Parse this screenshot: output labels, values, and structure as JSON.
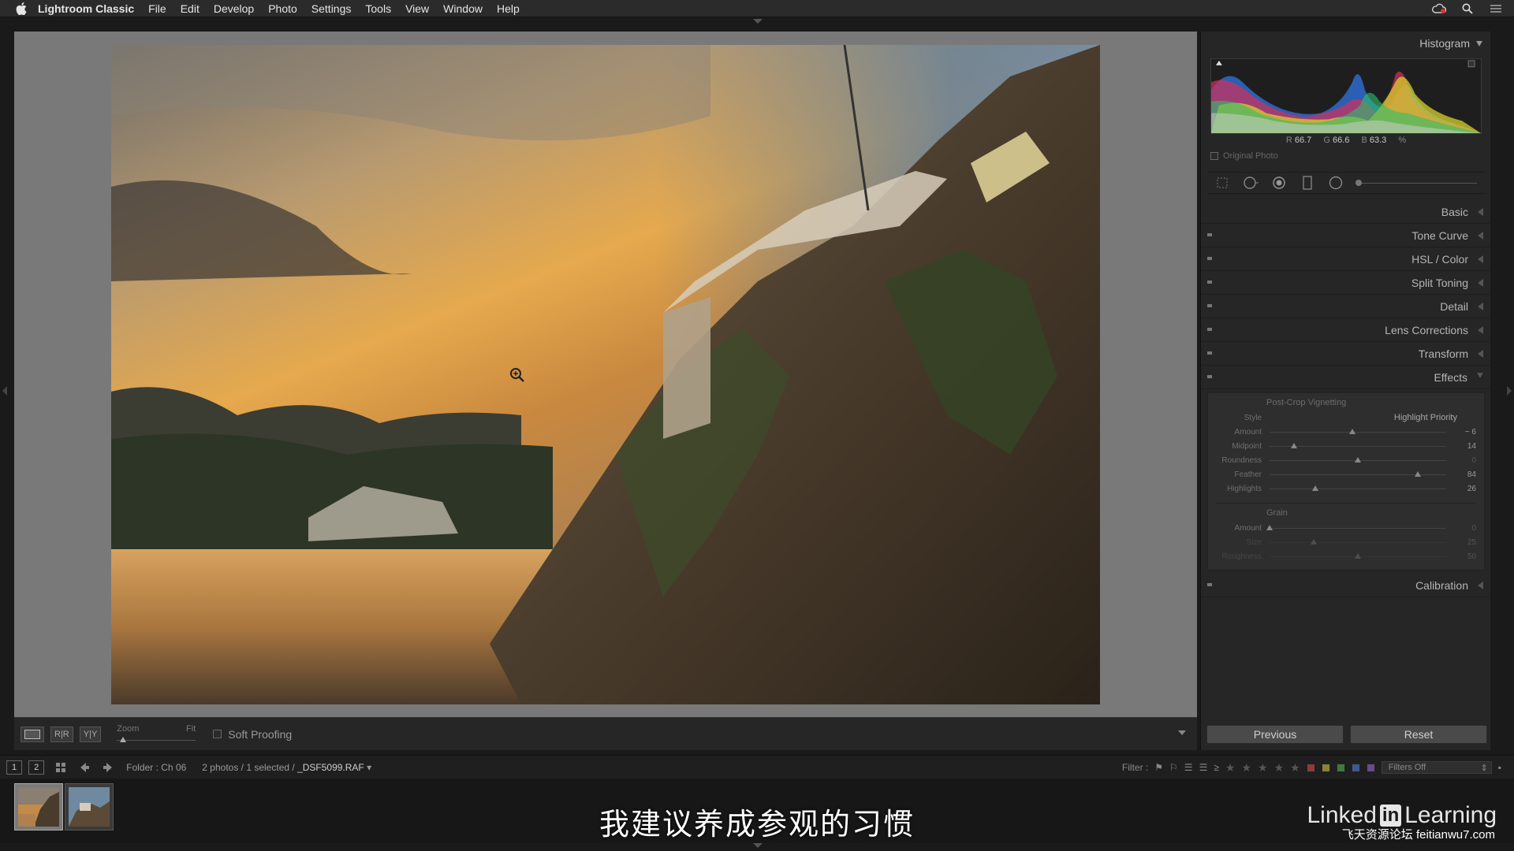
{
  "menubar": {
    "app_name": "Lightroom Classic",
    "items": [
      "File",
      "Edit",
      "Develop",
      "Photo",
      "Settings",
      "Tools",
      "View",
      "Window",
      "Help"
    ]
  },
  "toolbar": {
    "zoom_label": "Zoom",
    "fit_label": "Fit",
    "soft_proofing": "Soft Proofing"
  },
  "right_panel": {
    "histogram_title": "Histogram",
    "rgb": {
      "r_label": "R",
      "r_value": "66.7",
      "g_label": "G",
      "g_value": "66.6",
      "b_label": "B",
      "b_value": "63.3",
      "unit": "%"
    },
    "original_photo": "Original Photo",
    "sections": {
      "basic": "Basic",
      "tone_curve": "Tone Curve",
      "hsl_color": "HSL / Color",
      "split_toning": "Split Toning",
      "detail": "Detail",
      "lens_corrections": "Lens Corrections",
      "transform": "Transform",
      "effects": "Effects",
      "calibration": "Calibration"
    },
    "effects": {
      "vignette_title": "Post-Crop Vignetting",
      "style_label": "Style",
      "style_value": "Highlight Priority",
      "amount_label": "Amount",
      "amount_value": "− 6",
      "amount_level": 0.47,
      "midpoint_label": "Midpoint",
      "midpoint_value": "14",
      "midpoint_level": 0.14,
      "roundness_label": "Roundness",
      "roundness_value": "0",
      "roundness_level": 0.5,
      "feather_label": "Feather",
      "feather_value": "84",
      "feather_level": 0.84,
      "highlights_label": "Highlights",
      "highlights_value": "26",
      "highlights_level": 0.26,
      "grain_title": "Grain",
      "grain_amount_label": "Amount",
      "grain_amount_value": "0",
      "grain_amount_level": 0.0,
      "size_label": "Size",
      "size_value": "25",
      "size_level": 0.25,
      "roughness_label": "Roughness",
      "roughness_value": "50",
      "roughness_level": 0.5
    },
    "previous_button": "Previous",
    "reset_button": "Reset"
  },
  "filmstrip_bar": {
    "view1": "1",
    "view2": "2",
    "folder": "Folder : Ch 06",
    "count_prefix": "2 photos / 1 selected /",
    "filename": "_DSF5099.RAF",
    "filter_label": "Filter :",
    "filters_off": "Filters Off"
  },
  "colors": {
    "label_red": "#8a3c3c",
    "label_yellow": "#8a8336",
    "label_green": "#3e7a3e",
    "label_blue": "#3e5a8a",
    "label_purple": "#6a4a8a"
  },
  "subtitle": "我建议养成参观的习惯",
  "watermark": {
    "linked": "Linked",
    "in": "in",
    "learning": "Learning",
    "site": "飞天资源论坛 feitianwu7.com"
  }
}
